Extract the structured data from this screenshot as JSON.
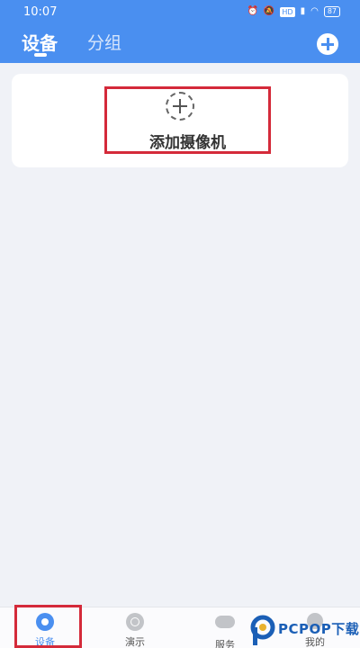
{
  "status_bar": {
    "time": "10:07",
    "icons": [
      "alarm-icon",
      "mute-icon",
      "hd-icon",
      "signal-icon",
      "wifi-icon",
      "battery-icon"
    ],
    "hd_label": "HD",
    "battery_level": "87"
  },
  "header": {
    "active_tab": "设备",
    "other_tab": "分组",
    "add_icon": "add-circle-icon"
  },
  "main": {
    "add_camera_label": "添加摄像机",
    "add_camera_icon": "dashed-plus-circle-icon"
  },
  "bottom_nav": {
    "items": [
      {
        "label": "设备",
        "icon": "camera-icon",
        "active": true
      },
      {
        "label": "演示",
        "icon": "demo-icon",
        "active": false
      },
      {
        "label": "服务",
        "icon": "cloud-icon",
        "active": false
      },
      {
        "label": "我的",
        "icon": "user-icon",
        "active": false
      }
    ]
  },
  "watermark": {
    "text": "PCPOP下载"
  },
  "colors": {
    "primary": "#4a8ff0",
    "highlight_frame": "#d42a3a",
    "background": "#f0f2f7"
  }
}
